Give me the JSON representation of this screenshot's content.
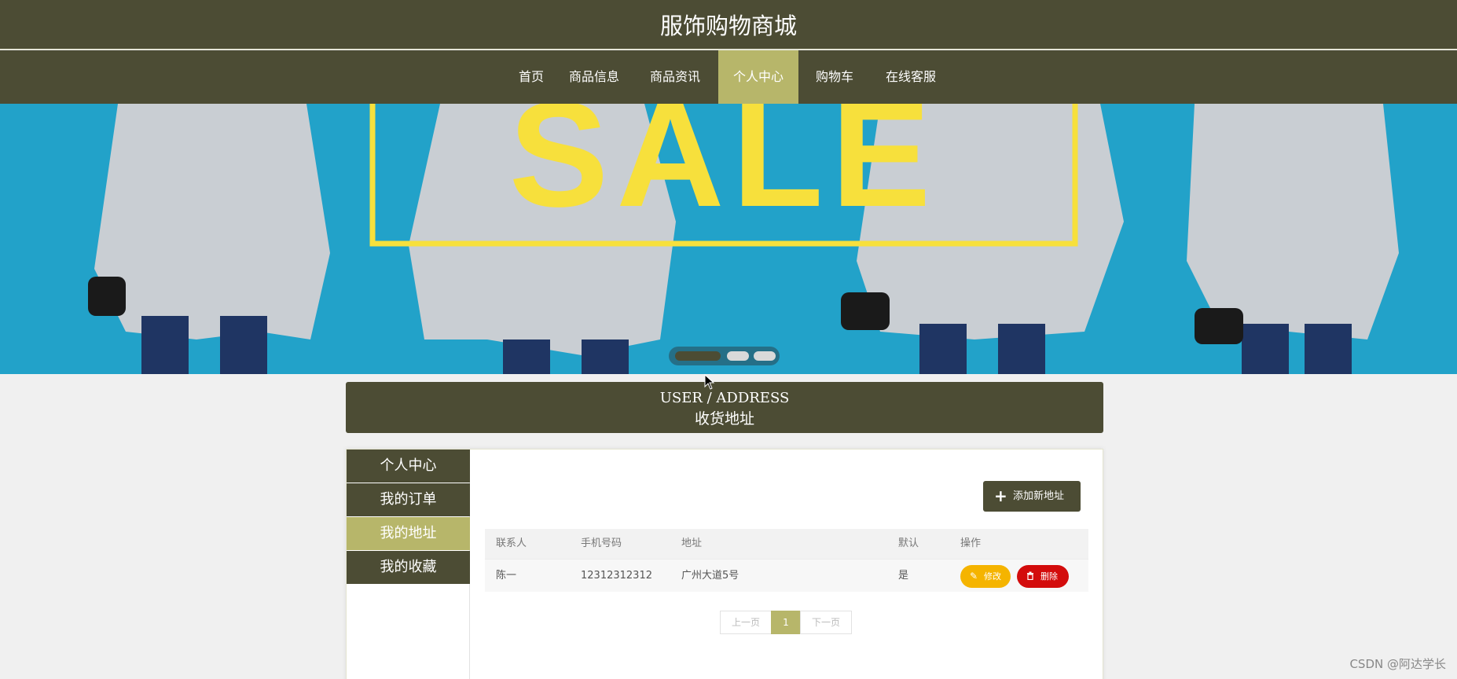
{
  "header": {
    "site_title": "服饰购物商城"
  },
  "nav": {
    "items": [
      {
        "label": "首页"
      },
      {
        "label": "商品信息"
      },
      {
        "label": "商品资讯"
      },
      {
        "label": "个人中心"
      },
      {
        "label": "购物车"
      },
      {
        "label": "在线客服"
      }
    ],
    "active": "个人中心"
  },
  "banner": {
    "text": "SALE",
    "slide_count": 3,
    "active_slide": 1
  },
  "section": {
    "title_en": "USER / ADDRESS",
    "title_cn": "收货地址"
  },
  "sidebar": {
    "items": [
      {
        "label": "个人中心"
      },
      {
        "label": "我的订单"
      },
      {
        "label": "我的地址"
      },
      {
        "label": "我的收藏"
      }
    ],
    "active": "我的地址"
  },
  "actions": {
    "add_address": "添加新地址"
  },
  "table": {
    "headers": {
      "contact": "联系人",
      "phone": "手机号码",
      "address": "地址",
      "default": "默认",
      "operation": "操作"
    },
    "rows": [
      {
        "contact": "陈一",
        "phone": "12312312312",
        "address": "广州大道5号",
        "default": "是",
        "edit": "修改",
        "delete": "删除"
      }
    ]
  },
  "pager": {
    "prev": "上一页",
    "current": "1",
    "next": "下一页"
  },
  "watermark": "CSDN @阿达学长",
  "colors": {
    "primary": "#4c4c34",
    "accent": "#b7b66a",
    "edit": "#f5b400",
    "delete": "#d30c0c",
    "banner_bg": "#22a2c9",
    "sale_yellow": "#f7e03c"
  }
}
